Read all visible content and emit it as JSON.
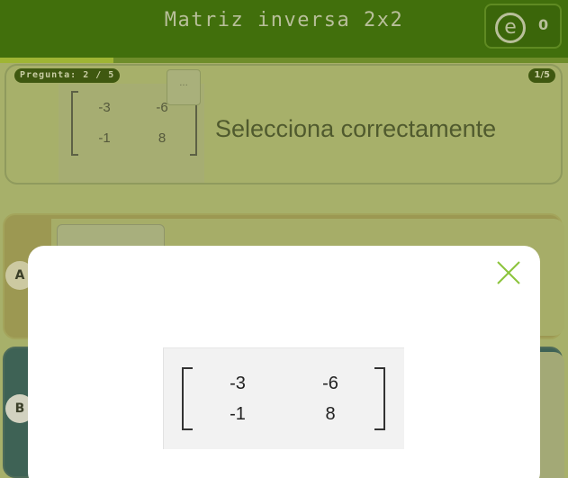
{
  "header": {
    "title": "Matriz inversa 2x2",
    "score_icon": "e",
    "score": "0",
    "progress": 0.2
  },
  "question": {
    "badge": "Pregunta: 2 / 5",
    "counter": "1/5",
    "prompt": "Selecciona correctamente",
    "matrix": [
      [
        "-3",
        "-6"
      ],
      [
        "-1",
        "8"
      ]
    ],
    "expand_icon": "..."
  },
  "options": {
    "a_label": "A",
    "b_label": "B"
  },
  "modal": {
    "close_icon": "close-icon",
    "close_color": "#8cc43c",
    "matrix": [
      [
        "-3",
        "-6"
      ],
      [
        "-1",
        "8"
      ]
    ]
  }
}
